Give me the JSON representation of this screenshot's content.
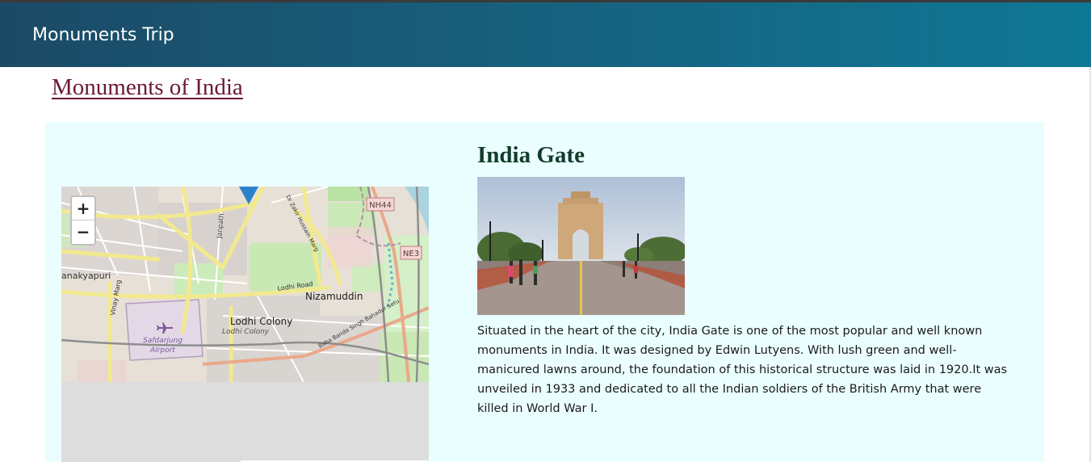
{
  "navbar": {
    "brand": "Monuments Trip"
  },
  "page": {
    "heading": "Monuments of India"
  },
  "monument": {
    "name": "India Gate",
    "description_lines": [
      "Situated in the heart of the city, India Gate is one of the most popular and well known",
      "monuments in India. It was designed by Edwin Lutyens. With lush green and well-",
      "manicured lawns around, the foundation of this historical structure was laid in 1920.It was",
      "unveiled in 1933 and dedicated to all the Indian soldiers of the British Army that were",
      "killed in World War I."
    ]
  },
  "map": {
    "zoom_in_label": "+",
    "zoom_out_label": "−",
    "labels": {
      "janakpuri": "anakyapuri",
      "vinay_marg": "Vinay Marg",
      "janpath": "Janpath",
      "zakir_marg": "Dr Zakir Hussain Marg",
      "nh44": "NH44",
      "ne3": "NE3",
      "lodhi_road": "Lodhi Road",
      "nizamuddin": "Nizamuddin",
      "lodhi_colony": "Lodhi Colony",
      "lodhi_colony_sub": "Lodhi Colony",
      "safdarjung": "Safdarjung",
      "airport": "Airport",
      "setu": "Baba Banda Singh Bahadur Setu"
    },
    "colors": {
      "marker": "#2a81cb",
      "road": "#f7f2a2",
      "park": "#c8e9b3",
      "water": "#a9d3df"
    }
  },
  "colors": {
    "navbar_start": "#1b4a66",
    "navbar_end": "#0e7895",
    "heading_link": "#6b1836",
    "card_background": "#ebfeff",
    "title": "#123b2c"
  }
}
